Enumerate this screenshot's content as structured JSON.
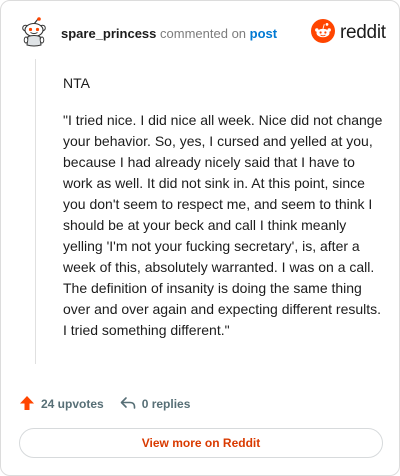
{
  "header": {
    "username": "spare_princess",
    "commented_text": "commented on",
    "post_link": "post",
    "brand": "reddit",
    "avatar_icon": "snoo-avatar-icon",
    "brand_icon": "reddit-logo-icon",
    "brand_color": "#ff4500"
  },
  "comment": {
    "paragraph1": "NTA",
    "paragraph2": "\"I tried nice. I did nice all week. Nice did not change your behavior. So, yes, I cursed and yelled at you, because I had already nicely said that I have to work as well. It did not sink in. At this point, since you don't seem to respect me, and seem to think I should be at your beck and call I think meanly yelling 'I'm not your fucking secretary', is, after a week of this, absolutely warranted. I was on a call. The definition of insanity is doing the same thing over and over again and expecting different results. I tried something different.\""
  },
  "footer": {
    "upvotes": "24 upvotes",
    "replies": "0 replies",
    "upvote_icon": "upvote-arrow-icon",
    "reply_icon": "reply-arrow-icon",
    "upvote_color": "#ff4500"
  },
  "cta": {
    "label": "View more on Reddit",
    "color": "#d93a00"
  }
}
